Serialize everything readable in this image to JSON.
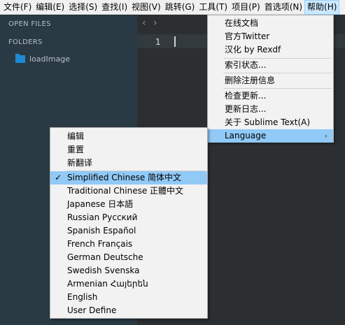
{
  "menubar": {
    "items": [
      {
        "label": "文件(F)"
      },
      {
        "label": "编辑(E)"
      },
      {
        "label": "选择(S)"
      },
      {
        "label": "查找(I)"
      },
      {
        "label": "视图(V)"
      },
      {
        "label": "跳转(G)"
      },
      {
        "label": "工具(T)"
      },
      {
        "label": "项目(P)"
      },
      {
        "label": "首选项(N)"
      },
      {
        "label": "帮助(H)"
      }
    ]
  },
  "sidebar": {
    "open_files": "OPEN FILES",
    "folders": "FOLDERS",
    "folder_name": "loadImage"
  },
  "editor": {
    "back_arrow": "‹",
    "forward_arrow": "›",
    "line_number": "1"
  },
  "help_menu": {
    "items": [
      {
        "label": "在线文档"
      },
      {
        "label": "官方Twitter"
      },
      {
        "label": "汉化 by Rexdf"
      },
      {
        "label": "索引状态..."
      },
      {
        "label": "删除注册信息"
      },
      {
        "label": "检查更新..."
      },
      {
        "label": "更新日志..."
      },
      {
        "label": "关于 Sublime Text(A)"
      },
      {
        "label": "Language"
      }
    ],
    "submenu_arrow": "›"
  },
  "language_menu": {
    "items": [
      {
        "label": "编辑"
      },
      {
        "label": "重置"
      },
      {
        "label": "新翻译"
      },
      {
        "label": "Simplified Chinese 简体中文"
      },
      {
        "label": "Traditional Chinese 正體中文"
      },
      {
        "label": "Japanese 日本語"
      },
      {
        "label": "Russian Русский"
      },
      {
        "label": "Spanish Español"
      },
      {
        "label": "French Français"
      },
      {
        "label": "German Deutsche"
      },
      {
        "label": "Swedish Svenska"
      },
      {
        "label": "Armenian Հայերեն"
      },
      {
        "label": "English"
      },
      {
        "label": "User Define"
      }
    ],
    "check": "✓"
  },
  "colors": {
    "highlight": "#91c9f7",
    "sidebar_bg": "#2a3a44",
    "editor_bg": "#2b2f32",
    "folder_icon": "#1e8ad2"
  }
}
